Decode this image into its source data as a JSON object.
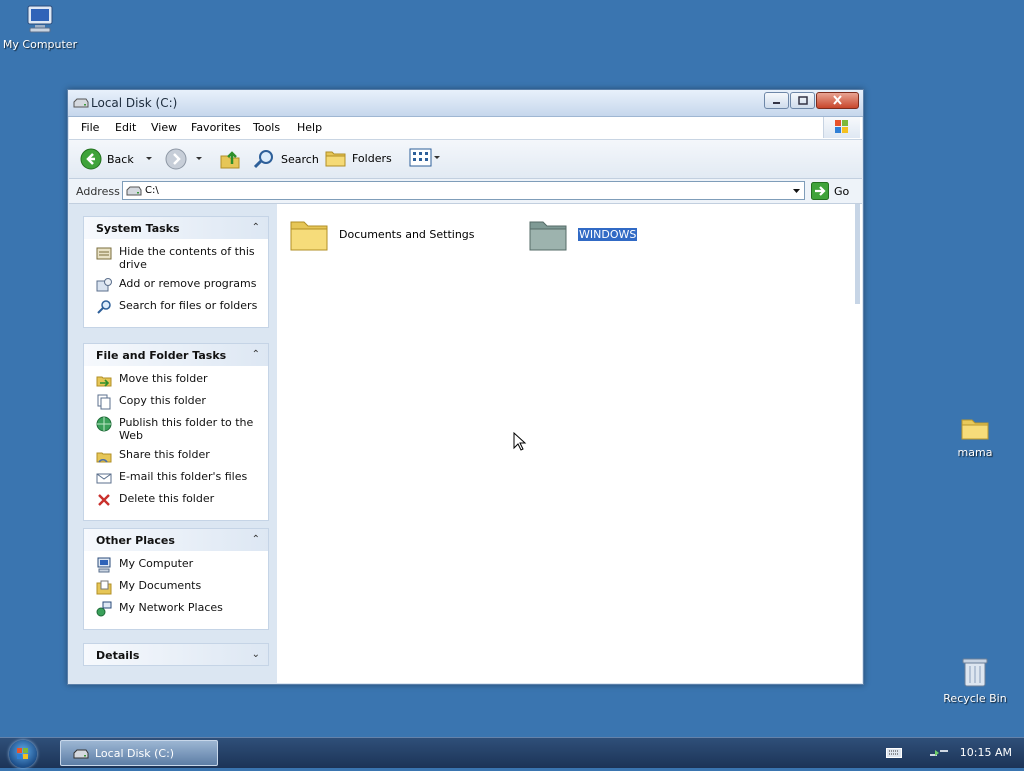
{
  "desktop": {
    "icons": [
      {
        "label": "My Computer",
        "icon": "my-computer-icon"
      },
      {
        "label": "mama",
        "icon": "folder-icon"
      },
      {
        "label": "Recycle Bin",
        "icon": "recycle-bin-icon"
      }
    ]
  },
  "window": {
    "title": "Local Disk (C:)",
    "menu": [
      "File",
      "Edit",
      "View",
      "Favorites",
      "Tools",
      "Help"
    ],
    "toolbar": {
      "back_label": "Back",
      "search_label": "Search",
      "folders_label": "Folders"
    },
    "address": {
      "label": "Address",
      "value": "C:\\",
      "go_label": "Go"
    },
    "panels": {
      "system_tasks": {
        "title": "System Tasks",
        "items": [
          "Hide the contents of this drive",
          "Add or remove programs",
          "Search for files or folders"
        ]
      },
      "file_folder_tasks": {
        "title": "File and Folder Tasks",
        "items": [
          "Move this folder",
          "Copy this folder",
          "Publish this folder to the Web",
          "Share this folder",
          "E-mail this folder's files",
          "Delete this folder"
        ]
      },
      "other_places": {
        "title": "Other Places",
        "items": [
          "My Computer",
          "My Documents",
          "My Network Places"
        ]
      },
      "details": {
        "title": "Details"
      }
    },
    "files": [
      {
        "name": "Documents and Settings",
        "selected": false
      },
      {
        "name": "WINDOWS",
        "selected": true
      }
    ]
  },
  "taskbar": {
    "task_label": "Local Disk (C:)",
    "clock": "10:15 AM"
  },
  "colors": {
    "desktop": "#3a75b0",
    "selection": "#316ac5",
    "pane": "#dbe6f2"
  }
}
